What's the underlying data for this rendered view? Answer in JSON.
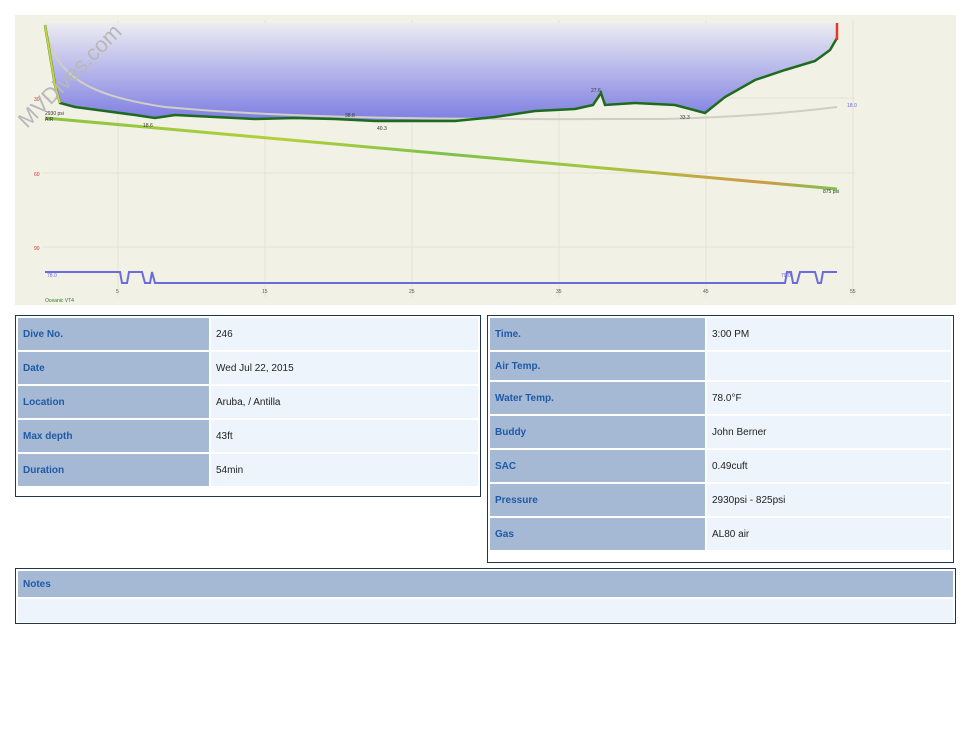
{
  "watermark": "MVDives.com",
  "profile": {
    "depth_ticks": [
      "30",
      "60",
      "90"
    ],
    "time_ticks": [
      "5",
      "15",
      "25",
      "35",
      "45",
      "55"
    ],
    "pressure_start": "2930 psi",
    "pressure_end": "875 psi",
    "gas_label": "AIR",
    "depth_callouts": [
      "18.6",
      "38.8",
      "40.3",
      "27.6",
      "33.3"
    ],
    "temp_start": "78.0",
    "temp_end": "79.0",
    "right_readout": "18.0",
    "computer": "Oceanic VT4",
    "colors": {
      "depth_line": "#1e6b1e",
      "fill_top": "#e6e6f0",
      "fill_bottom": "#7b7be0",
      "pressure_line": "#7ec23c",
      "temp_line": "#6b6bdd",
      "bg": "#f1f1e6"
    }
  },
  "info_left": [
    {
      "label": "Dive No.",
      "value": "246"
    },
    {
      "label": "Date",
      "value": "Wed Jul 22, 2015"
    },
    {
      "label": "Location",
      "value": "Aruba, / Antilla"
    },
    {
      "label": "Max depth",
      "value": "43ft"
    },
    {
      "label": "Duration",
      "value": "54min"
    }
  ],
  "info_right": [
    {
      "label": "Time.",
      "value": "3:00 PM"
    },
    {
      "label": "Air Temp.",
      "value": ""
    },
    {
      "label": "Water Temp.",
      "value": "78.0°F"
    },
    {
      "label": "Buddy",
      "value": "John Berner"
    },
    {
      "label": "SAC",
      "value": "0.49cuft"
    },
    {
      "label": "Pressure",
      "value": "2930psi - 825psi"
    },
    {
      "label": "Gas",
      "value": "AL80 air"
    }
  ],
  "notes": {
    "label": "Notes",
    "value": ""
  }
}
